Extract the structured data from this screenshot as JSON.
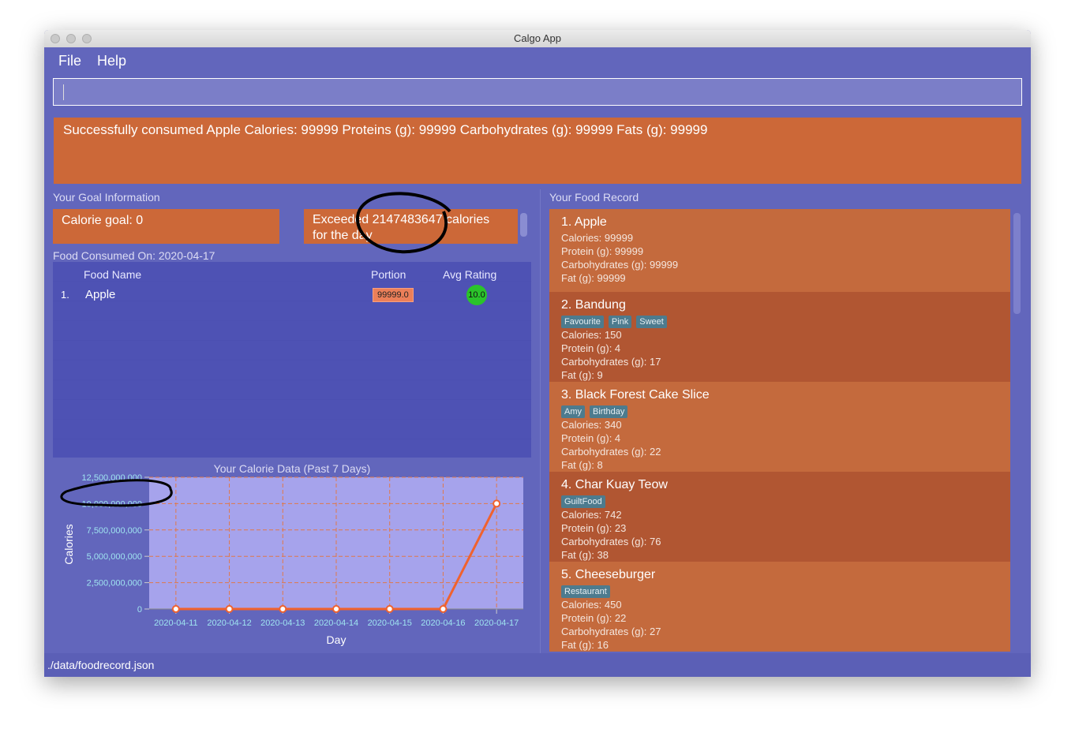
{
  "window": {
    "title": "Calgo App"
  },
  "menu": {
    "file": "File",
    "help": "Help"
  },
  "command": {
    "value": ""
  },
  "result": {
    "text": "Successfully consumed Apple Calories: 99999 Proteins (g): 99999 Carbohydrates (g): 99999 Fats (g): 99999"
  },
  "goal": {
    "heading": "Your Goal Information",
    "calorie_goal": "Calorie goal: 0",
    "message": "Exceeded 2147483647 calories for the day"
  },
  "consumed": {
    "heading": "Food Consumed On: 2020-04-17",
    "col_name": "Food Name",
    "col_portion": "Portion",
    "col_rating": "Avg Rating",
    "rows": [
      {
        "index": "1.",
        "name": "Apple",
        "portion": "99999.0",
        "rating": "10.0"
      }
    ]
  },
  "chart_data": {
    "type": "line",
    "title": "Your Calorie Data (Past 7 Days)",
    "xlabel": "Day",
    "ylabel": "Calories",
    "categories": [
      "2020-04-11",
      "2020-04-12",
      "2020-04-13",
      "2020-04-14",
      "2020-04-15",
      "2020-04-16",
      "2020-04-17"
    ],
    "values": [
      0,
      0,
      0,
      0,
      0,
      0,
      9999800001
    ],
    "ylim": [
      0,
      12500000000
    ],
    "yticks": [
      "0",
      "2,500,000,000",
      "5,000,000,000",
      "7,500,000,000",
      "10,000,000,000",
      "12,500,000,000"
    ],
    "grid": true,
    "color": "#f0622e"
  },
  "record": {
    "heading": "Your Food Record",
    "items": [
      {
        "title": "1.  Apple",
        "tags": [],
        "calories": "Calories: 99999",
        "protein": "Protein (g): 99999",
        "carbs": "Carbohydrates (g): 99999",
        "fat": "Fat (g): 99999"
      },
      {
        "title": "2.  Bandung",
        "tags": [
          "Favourite",
          "Pink",
          "Sweet"
        ],
        "calories": "Calories: 150",
        "protein": "Protein (g): 4",
        "carbs": "Carbohydrates (g): 17",
        "fat": "Fat (g): 9"
      },
      {
        "title": "3.  Black Forest Cake Slice",
        "tags": [
          "Amy",
          "Birthday"
        ],
        "calories": "Calories: 340",
        "protein": "Protein (g): 4",
        "carbs": "Carbohydrates (g): 22",
        "fat": "Fat (g): 8"
      },
      {
        "title": "4.  Char Kuay Teow",
        "tags": [
          "GuiltFood"
        ],
        "calories": "Calories: 742",
        "protein": "Protein (g): 23",
        "carbs": "Carbohydrates (g): 76",
        "fat": "Fat (g): 38"
      },
      {
        "title": "5.  Cheeseburger",
        "tags": [
          "Restaurant"
        ],
        "calories": "Calories: 450",
        "protein": "Protein (g): 22",
        "carbs": "Carbohydrates (g): 27",
        "fat": "Fat (g): 16"
      }
    ]
  },
  "status": {
    "path": "./data/foodrecord.json"
  }
}
